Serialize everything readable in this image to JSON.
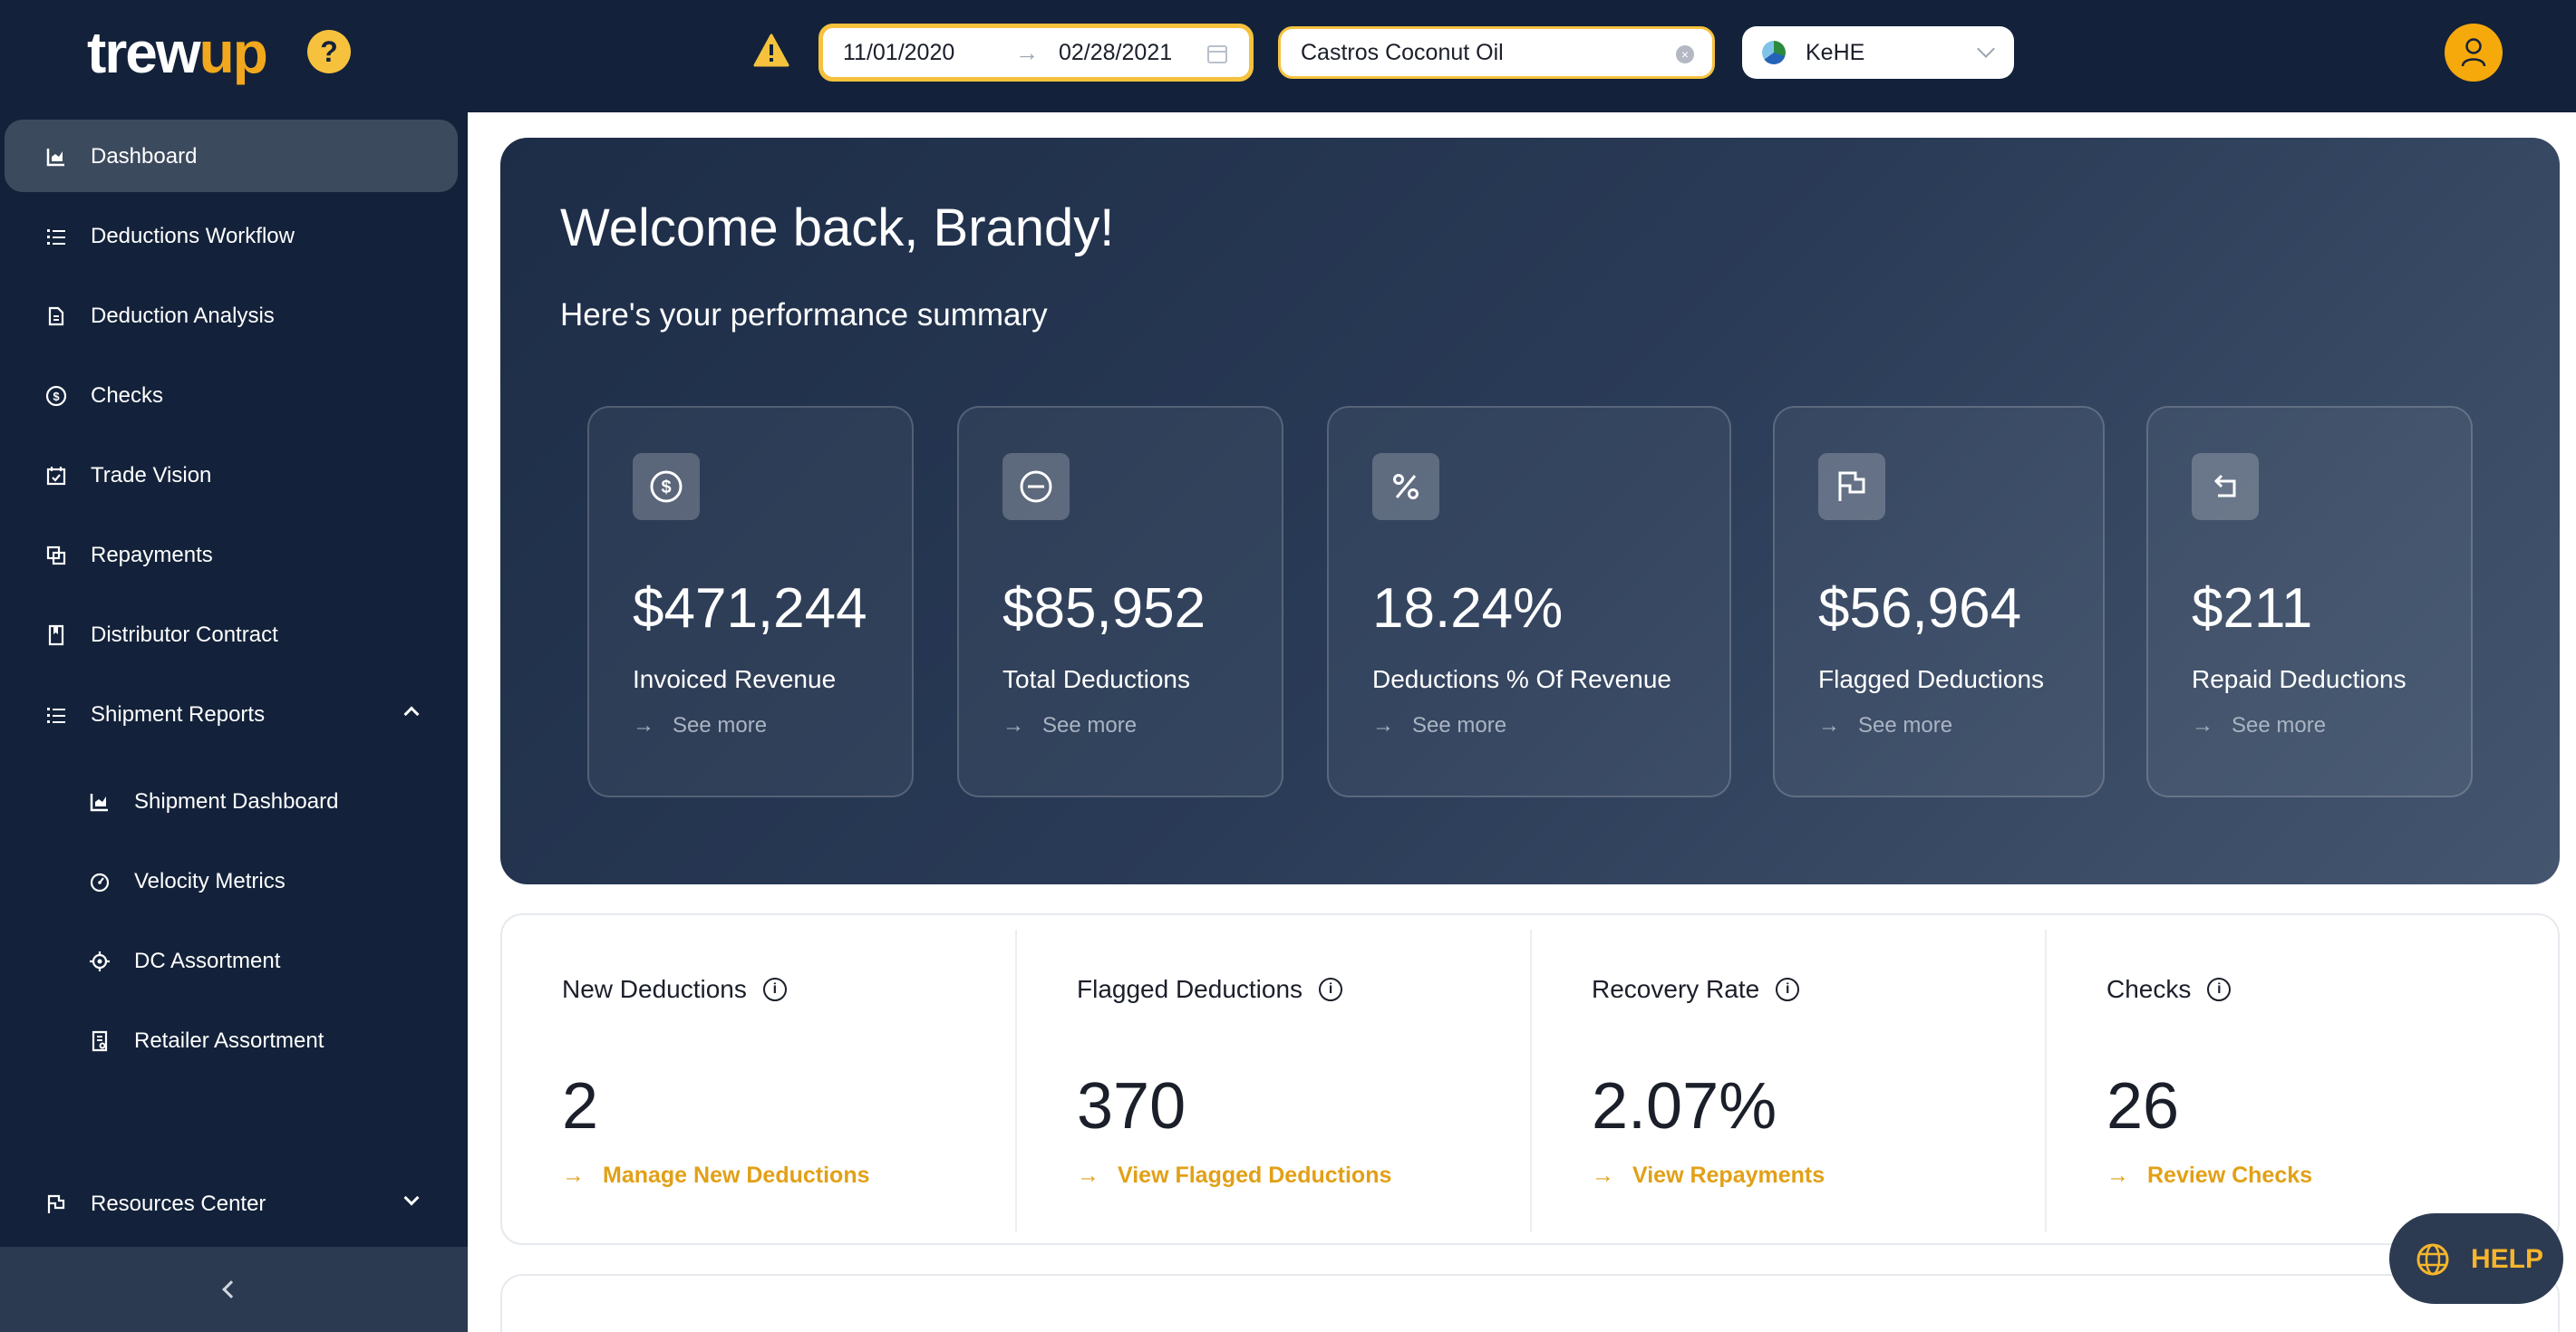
{
  "topbar": {
    "logo_a": "trew",
    "logo_b": "up",
    "help_badge": "?",
    "date_start": "11/01/2020",
    "date_arrow": "→",
    "date_end": "02/28/2021",
    "product": "Castros Coconut Oil",
    "distributor": "KeHE"
  },
  "sidebar": {
    "items": [
      {
        "label": "Dashboard",
        "icon": "chart-icon"
      },
      {
        "label": "Deductions Workflow",
        "icon": "list-icon"
      },
      {
        "label": "Deduction Analysis",
        "icon": "document-icon"
      },
      {
        "label": "Checks",
        "icon": "dollar-icon"
      },
      {
        "label": "Trade Vision",
        "icon": "calendar-check-icon"
      },
      {
        "label": "Repayments",
        "icon": "copy-icon"
      },
      {
        "label": "Distributor Contract",
        "icon": "book-icon"
      },
      {
        "label": "Shipment Reports",
        "icon": "list-icon"
      },
      {
        "label": "Shipment Dashboard",
        "icon": "chart-icon"
      },
      {
        "label": "Velocity Metrics",
        "icon": "gauge-icon"
      },
      {
        "label": "DC Assortment",
        "icon": "target-icon"
      },
      {
        "label": "Retailer Assortment",
        "icon": "receipt-icon"
      },
      {
        "label": "Resources Center",
        "icon": "flag-icon"
      }
    ],
    "collapse": "‹"
  },
  "hero": {
    "title": "Welcome back, Brandy!",
    "subtitle": "Here's your performance summary",
    "kpis": [
      {
        "value": "$471,244",
        "label": "Invoiced Revenue",
        "link": "See more",
        "icon": "dollar-icon"
      },
      {
        "value": "$85,952",
        "label": "Total Deductions",
        "link": "See more",
        "icon": "minus-icon"
      },
      {
        "value": "18.24%",
        "label": "Deductions % Of Revenue",
        "link": "See more",
        "icon": "percent-icon"
      },
      {
        "value": "$56,964",
        "label": "Flagged Deductions",
        "link": "See more",
        "icon": "flag-icon"
      },
      {
        "value": "$211",
        "label": "Repaid Deductions",
        "link": "See more",
        "icon": "return-icon"
      }
    ]
  },
  "stats": [
    {
      "title": "New Deductions",
      "value": "2",
      "link": "Manage New Deductions"
    },
    {
      "title": "Flagged Deductions",
      "value": "370",
      "link": "View Flagged Deductions"
    },
    {
      "title": "Recovery Rate",
      "value": "2.07%",
      "link": "View Repayments"
    },
    {
      "title": "Checks",
      "value": "26",
      "link": "Review Checks"
    }
  ],
  "help_button": "HELP",
  "colors": {
    "navy": "#13223a",
    "accent": "#f6c23e",
    "link": "#e2a017"
  }
}
